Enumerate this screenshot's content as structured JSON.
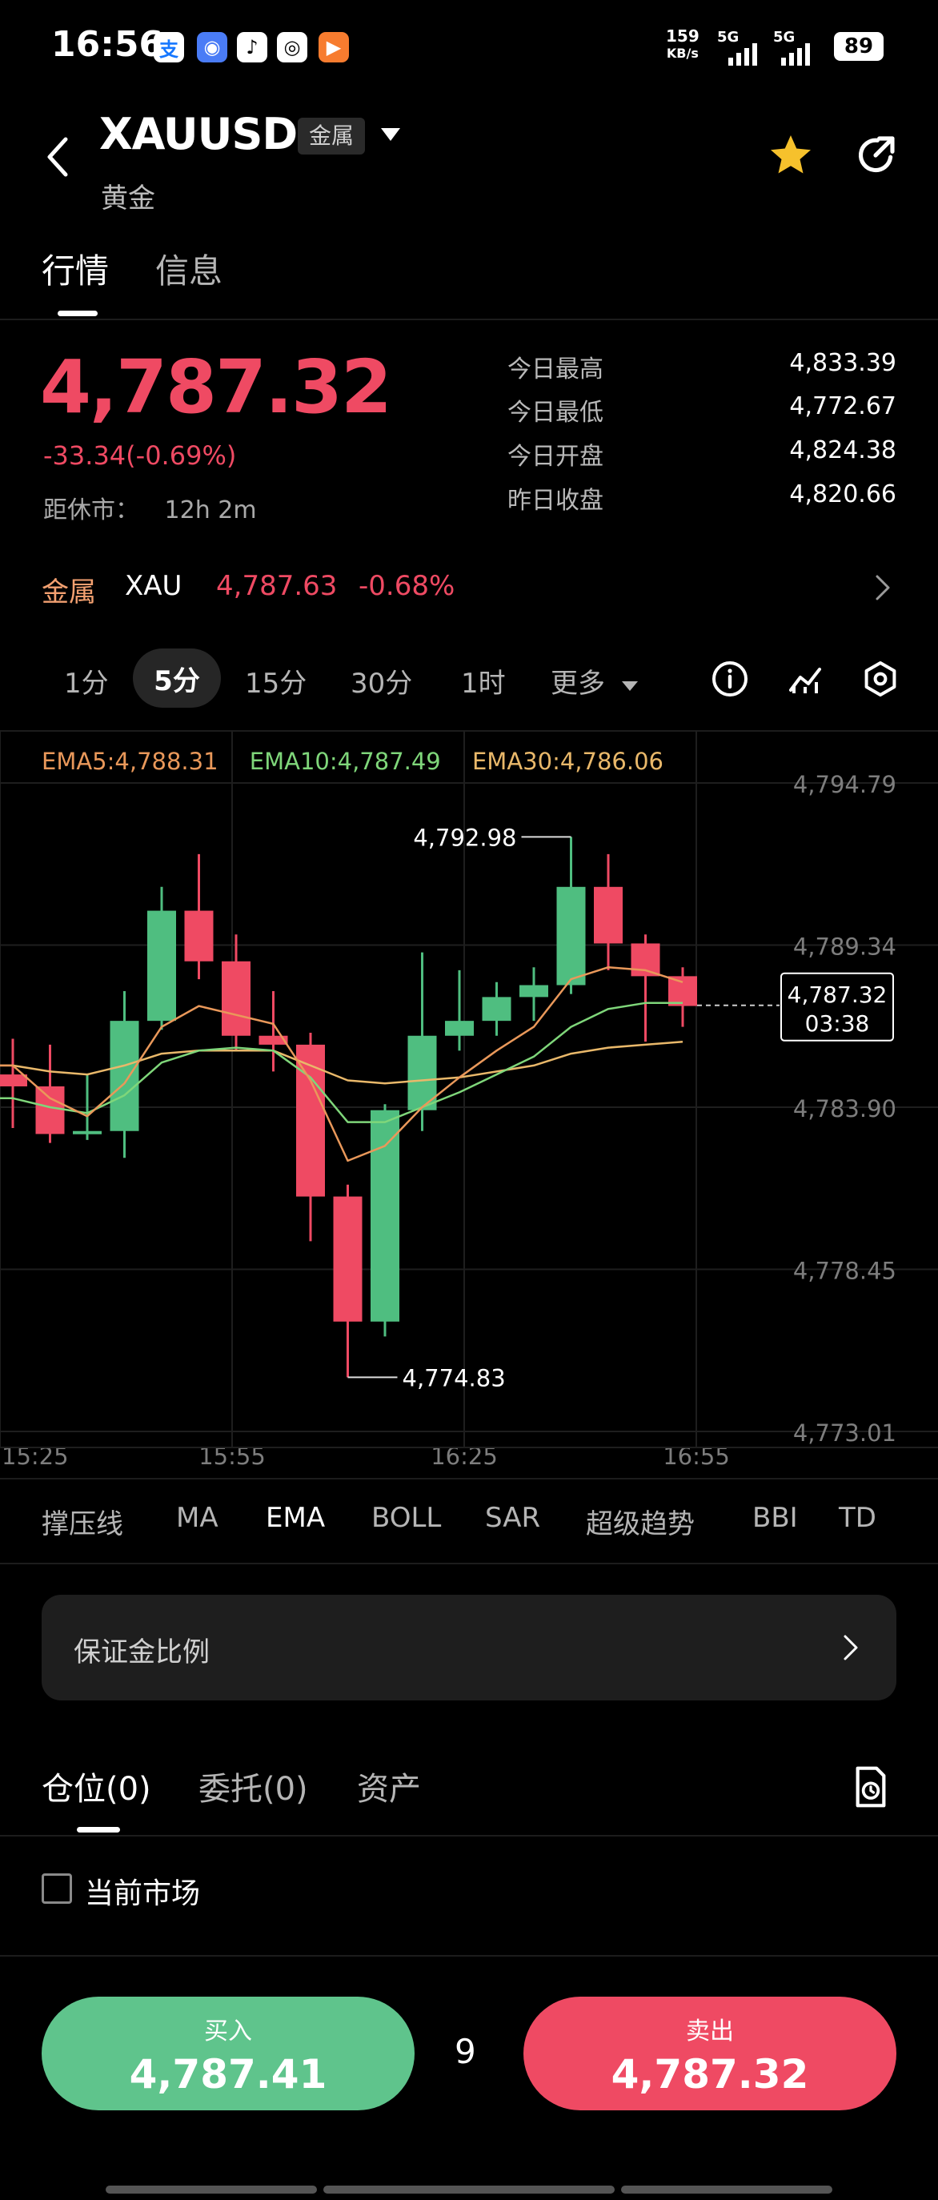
{
  "status_bar": {
    "time": "16:56",
    "net_speed": "159",
    "net_unit": "KB/s",
    "signal1": "5G",
    "signal2": "5G",
    "battery": "89"
  },
  "header": {
    "symbol": "XAUUSD",
    "badge": "金属",
    "name": "黄金"
  },
  "tabs": [
    {
      "label": "行情",
      "active": true
    },
    {
      "label": "信息",
      "active": false
    }
  ],
  "quote": {
    "price": "4,787.32",
    "change": "-33.34(-0.69%)",
    "close_label": "距休市：",
    "close_time": "12h 2m",
    "stats": [
      {
        "label": "今日最高",
        "value": "4,833.39"
      },
      {
        "label": "今日最低",
        "value": "4,772.67"
      },
      {
        "label": "今日开盘",
        "value": "4,824.38"
      },
      {
        "label": "昨日收盘",
        "value": "4,820.66"
      }
    ]
  },
  "metal_row": {
    "category": "金属",
    "code": "XAU",
    "price": "4,787.63",
    "change": "-0.68%"
  },
  "timeframes": {
    "items": [
      "1分",
      "5分",
      "15分",
      "30分",
      "1时"
    ],
    "active": "5分",
    "more": "更多"
  },
  "chart_data": {
    "type": "candlestick",
    "ema_labels": [
      {
        "text": "EMA5:4,788.31",
        "color": "#e9985a"
      },
      {
        "text": "EMA10:4,787.49",
        "color": "#7fd67a"
      },
      {
        "text": "EMA30:4,786.06",
        "color": "#e9b86a"
      }
    ],
    "y_ticks": [
      "4,794.79",
      "4,789.34",
      "4,783.90",
      "4,778.45",
      "4,773.01"
    ],
    "x_ticks": [
      "15:25",
      "15:55",
      "16:25",
      "16:55"
    ],
    "ylim": [
      4773.01,
      4794.79
    ],
    "candles": [
      {
        "o": 4785.0,
        "h": 4786.2,
        "l": 4783.2,
        "c": 4784.6
      },
      {
        "o": 4784.6,
        "h": 4786.0,
        "l": 4782.7,
        "c": 4783.0
      },
      {
        "o": 4783.0,
        "h": 4785.0,
        "l": 4782.8,
        "c": 4783.1
      },
      {
        "o": 4783.1,
        "h": 4787.8,
        "l": 4782.2,
        "c": 4786.8
      },
      {
        "o": 4786.8,
        "h": 4791.3,
        "l": 4786.5,
        "c": 4790.5
      },
      {
        "o": 4790.5,
        "h": 4792.4,
        "l": 4788.2,
        "c": 4788.8
      },
      {
        "o": 4788.8,
        "h": 4789.7,
        "l": 4785.8,
        "c": 4786.3
      },
      {
        "o": 4786.3,
        "h": 4787.8,
        "l": 4785.1,
        "c": 4786.0
      },
      {
        "o": 4786.0,
        "h": 4786.4,
        "l": 4779.4,
        "c": 4780.9
      },
      {
        "o": 4780.9,
        "h": 4781.3,
        "l": 4774.83,
        "c": 4776.7
      },
      {
        "o": 4776.7,
        "h": 4784.0,
        "l": 4776.2,
        "c": 4783.8
      },
      {
        "o": 4783.8,
        "h": 4789.1,
        "l": 4783.1,
        "c": 4786.3
      },
      {
        "o": 4786.3,
        "h": 4788.5,
        "l": 4785.8,
        "c": 4786.8
      },
      {
        "o": 4786.8,
        "h": 4788.1,
        "l": 4786.3,
        "c": 4787.6
      },
      {
        "o": 4787.6,
        "h": 4788.6,
        "l": 4786.8,
        "c": 4788.0
      },
      {
        "o": 4788.0,
        "h": 4792.98,
        "l": 4787.7,
        "c": 4791.3
      },
      {
        "o": 4791.3,
        "h": 4792.4,
        "l": 4788.5,
        "c": 4789.4
      },
      {
        "o": 4789.4,
        "h": 4789.7,
        "l": 4786.1,
        "c": 4788.3
      },
      {
        "o": 4788.3,
        "h": 4788.6,
        "l": 4786.6,
        "c": 4787.3
      }
    ],
    "ema5": [
      4785.3,
      4784.2,
      4783.6,
      4784.7,
      4786.6,
      4787.3,
      4787.0,
      4786.7,
      4784.8,
      4782.1,
      4782.6,
      4783.9,
      4784.9,
      4785.8,
      4786.6,
      4788.2,
      4788.6,
      4788.5,
      4788.1
    ],
    "ema10": [
      4784.2,
      4783.9,
      4783.7,
      4784.3,
      4785.4,
      4785.8,
      4785.9,
      4785.8,
      4784.9,
      4783.4,
      4783.4,
      4783.9,
      4784.4,
      4785.0,
      4785.6,
      4786.6,
      4787.2,
      4787.4,
      4787.4
    ],
    "ema30": [
      4785.3,
      4785.1,
      4785.0,
      4785.3,
      4785.7,
      4785.8,
      4785.8,
      4785.8,
      4785.3,
      4784.8,
      4784.7,
      4784.8,
      4784.9,
      4785.1,
      4785.3,
      4785.7,
      4785.9,
      4786.0,
      4786.1
    ],
    "high_annotation": "4,792.98",
    "low_annotation": "4,774.83",
    "last_price": "4,787.32",
    "last_countdown": "03:38",
    "colors": {
      "up": "#4fbe80",
      "down": "#ef4a63"
    }
  },
  "indicators": [
    "撑压线",
    "MA",
    "EMA",
    "BOLL",
    "SAR",
    "超级趋势",
    "BBI",
    "TD"
  ],
  "active_indicator": "EMA",
  "margin_label": "保证金比例",
  "position_tabs": [
    "仓位(0)",
    "委托(0)",
    "资产"
  ],
  "current_market_label": "当前市场",
  "trade": {
    "buy_label": "买入",
    "buy_price": "4,787.41",
    "lots": "9",
    "sell_label": "卖出",
    "sell_price": "4,787.32"
  }
}
